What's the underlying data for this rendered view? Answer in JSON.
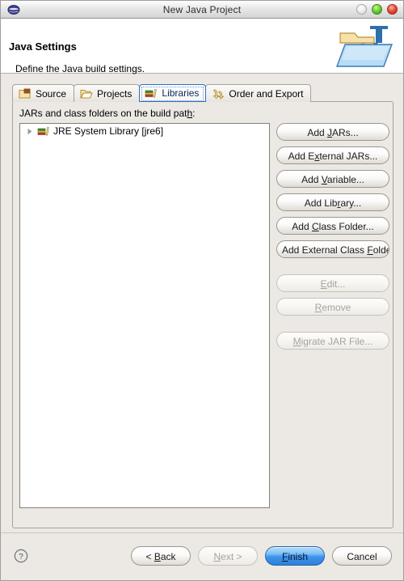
{
  "window": {
    "title": "New Java Project",
    "app_icon": "eclipse-sphere-icon",
    "controls": [
      {
        "name": "minimize",
        "color": "#e8e8e8"
      },
      {
        "name": "maximize",
        "color": "#6fd03a"
      },
      {
        "name": "close",
        "color": "#e8513c"
      }
    ]
  },
  "header": {
    "title": "Java Settings",
    "subtitle": "Define the Java build settings.",
    "banner_icon": "java-project-folder-icon"
  },
  "tabs": [
    {
      "label": "Source",
      "icon": "source-folder-icon",
      "selected": false
    },
    {
      "label": "Projects",
      "icon": "projects-folder-icon",
      "selected": false
    },
    {
      "label": "Libraries",
      "icon": "libraries-books-icon",
      "selected": true
    },
    {
      "label": "Order and Export",
      "icon": "order-export-arrows-icon",
      "selected": false
    }
  ],
  "panel": {
    "label_before": "JARs and class folders on the build pat",
    "label_mnemonic": "h",
    "label_after": ":",
    "tree_items": [
      {
        "label": "JRE System Library [jre6]",
        "icon": "library-books-icon",
        "expandable": true,
        "expanded": false
      }
    ]
  },
  "side_buttons": [
    {
      "pre": "Add ",
      "mnemonic": "J",
      "post": "ARs...",
      "enabled": true,
      "name": "add-jars-button"
    },
    {
      "pre": "Add E",
      "mnemonic": "x",
      "post": "ternal JARs...",
      "enabled": true,
      "name": "add-external-jars-button"
    },
    {
      "pre": "Add ",
      "mnemonic": "V",
      "post": "ariable...",
      "enabled": true,
      "name": "add-variable-button"
    },
    {
      "pre": "Add Lib",
      "mnemonic": "r",
      "post": "ary...",
      "enabled": true,
      "name": "add-library-button"
    },
    {
      "pre": "Add ",
      "mnemonic": "C",
      "post": "lass Folder...",
      "enabled": true,
      "name": "add-class-folder-button"
    },
    {
      "pre": "Add External Class ",
      "mnemonic": "F",
      "post": "older...",
      "enabled": true,
      "name": "add-external-class-folder-button"
    },
    {
      "pre": "",
      "mnemonic": "E",
      "post": "dit...",
      "enabled": false,
      "name": "edit-button",
      "gap": true
    },
    {
      "pre": "",
      "mnemonic": "R",
      "post": "emove",
      "enabled": false,
      "name": "remove-button"
    },
    {
      "pre": "",
      "mnemonic": "M",
      "post": "igrate JAR File...",
      "enabled": false,
      "name": "migrate-jar-file-button",
      "gap": true
    }
  ],
  "footer": {
    "help_icon": "help-question-icon",
    "buttons": [
      {
        "pre": "< ",
        "mnemonic": "B",
        "post": "ack",
        "enabled": true,
        "default": false,
        "name": "back-button"
      },
      {
        "pre": "",
        "mnemonic": "N",
        "post": "ext >",
        "enabled": false,
        "default": false,
        "name": "next-button"
      },
      {
        "pre": "",
        "mnemonic": "F",
        "post": "inish",
        "enabled": true,
        "default": true,
        "name": "finish-button"
      },
      {
        "pre": "Cancel",
        "mnemonic": "",
        "post": "",
        "enabled": true,
        "default": false,
        "name": "cancel-button"
      }
    ]
  },
  "colors": {
    "dialog_background": "#ece9e4",
    "panel_border": "#a6a29b",
    "selected_tab_border": "#2b6ec6",
    "default_button_blue": "#3e93ea",
    "list_background": "#ffffff"
  }
}
